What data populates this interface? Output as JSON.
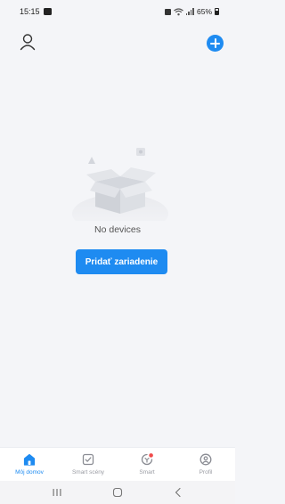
{
  "status_bar": {
    "time": "15:15",
    "battery": "65%"
  },
  "header": {
    "profile_icon": "user-icon",
    "add_icon": "plus-circle-icon"
  },
  "empty_state": {
    "illustration": "empty-box-illustration",
    "message": "No devices",
    "button_label": "Pridať zariadenie"
  },
  "bottom_nav": {
    "items": [
      {
        "label": "Môj domov",
        "icon": "home-icon",
        "active": true
      },
      {
        "label": "Smart scény",
        "icon": "checkbox-icon",
        "active": false
      },
      {
        "label": "Smart",
        "icon": "smart-icon",
        "active": false
      },
      {
        "label": "Profil",
        "icon": "profile-icon",
        "active": false
      }
    ]
  },
  "colors": {
    "accent": "#1e8bf1",
    "background": "#f4f5f8",
    "inactive": "#9a9ca3",
    "badge": "#f04a4a"
  },
  "system_nav": {
    "buttons": [
      "recents",
      "home",
      "back"
    ]
  }
}
